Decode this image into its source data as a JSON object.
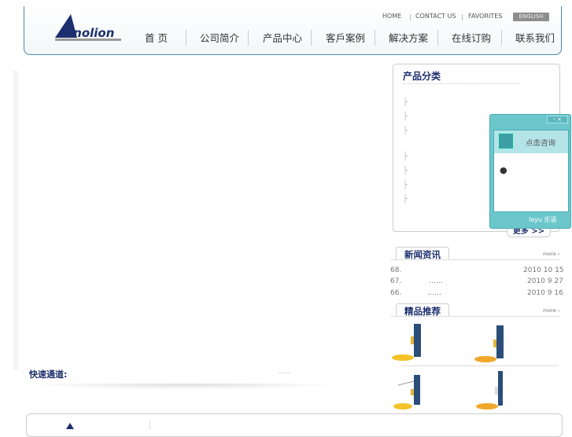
{
  "header": {
    "logo_text": "Sinolion",
    "toplinks": [
      "HOME",
      "CONTACT US",
      "FAVORITES"
    ],
    "english": "ENGLISH",
    "nav": [
      "首 页",
      "公司简介",
      "产品中心",
      "客戶案例",
      "解决方案",
      "在线订购",
      "联系我们"
    ]
  },
  "categories": {
    "title": "产品分类",
    "more": "更多 >>"
  },
  "chat": {
    "label": "点击咨询",
    "controls": "- ×",
    "brand": "leyu 乐语"
  },
  "news": {
    "title": "新闻资讯",
    "more": "more ›",
    "items": [
      {
        "num": "68.",
        "title": "",
        "date": "2010 10 15"
      },
      {
        "num": "67.",
        "title": "……",
        "date": "2010 9 27"
      },
      {
        "num": "66.",
        "title": "……",
        "date": "2010 9 16"
      }
    ]
  },
  "featured": {
    "title": "精品推荐",
    "more": "more ›"
  },
  "quick": {
    "label": "快速通道:",
    "dots": "……"
  },
  "colors": {
    "brand": "#1d2f6e",
    "chat": "#6cc7cc"
  }
}
